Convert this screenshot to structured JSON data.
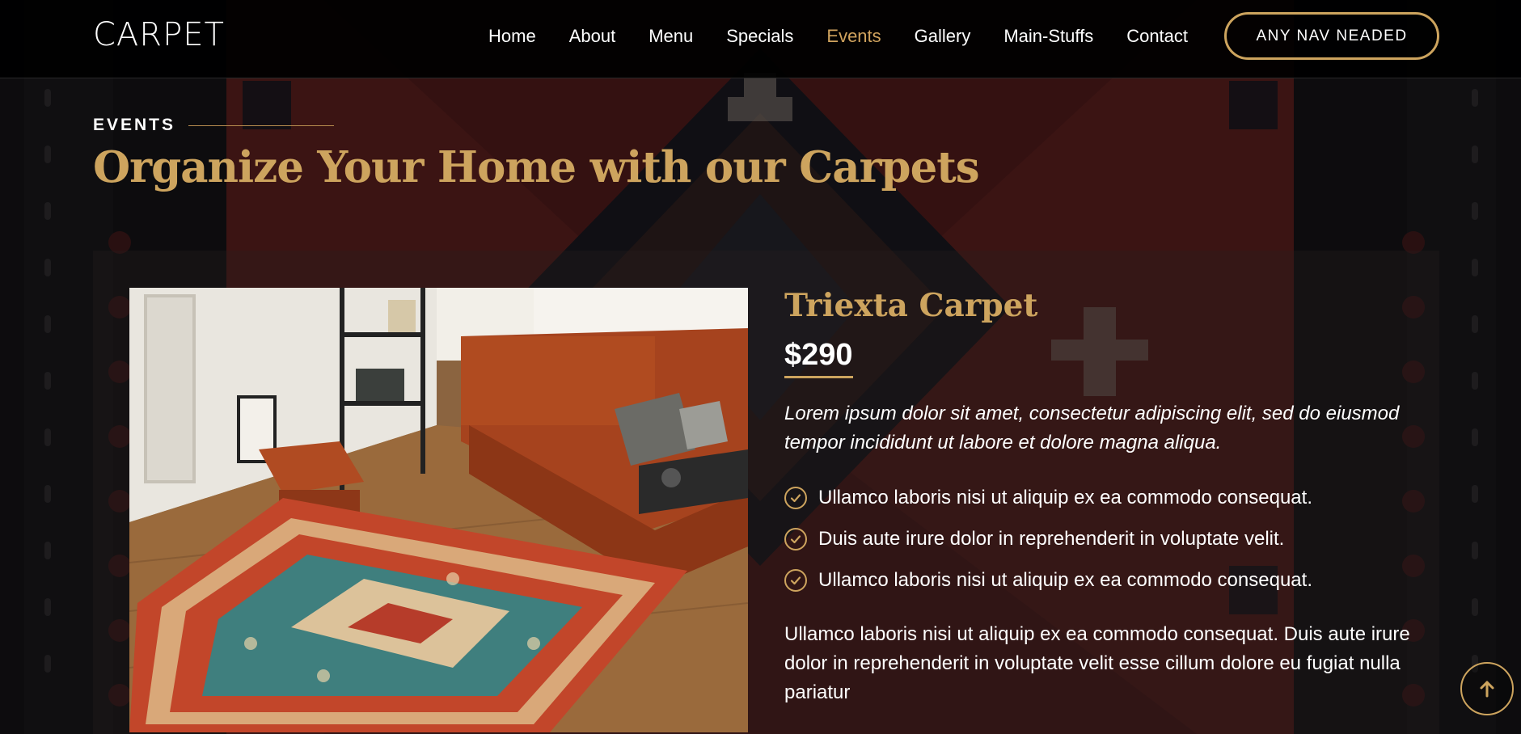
{
  "header": {
    "logo": "CARPET",
    "nav": [
      {
        "label": "Home",
        "active": false
      },
      {
        "label": "About",
        "active": false
      },
      {
        "label": "Menu",
        "active": false
      },
      {
        "label": "Specials",
        "active": false
      },
      {
        "label": "Events",
        "active": true
      },
      {
        "label": "Gallery",
        "active": false
      },
      {
        "label": "Main-Stuffs",
        "active": false
      },
      {
        "label": "Contact",
        "active": false
      }
    ],
    "cta_label": "ANY NAV NEADED"
  },
  "section": {
    "label": "EVENTS",
    "title": "Organize Your Home with our Carpets"
  },
  "product": {
    "title": "Triexta Carpet",
    "price": "$290",
    "lead": "Lorem ipsum dolor sit amet, consectetur adipiscing elit, sed do eiusmod tempor incididunt ut labore et dolore magna aliqua.",
    "features": [
      "Ullamco laboris nisi ut aliquip ex ea commodo consequat.",
      "Duis aute irure dolor in reprehenderit in voluptate velit.",
      "Ullamco laboris nisi ut aliquip ex ea commodo consequat."
    ],
    "description": "Ullamco laboris nisi ut aliquip ex ea commodo consequat. Duis aute irure dolor in reprehenderit in voluptate velit esse cillum dolore eu fugiat nulla pariatur"
  },
  "colors": {
    "accent": "#cda45e",
    "background": "#0b0b0b"
  },
  "icons": {
    "check": "check-circle-icon",
    "back_to_top": "arrow-up-icon"
  }
}
